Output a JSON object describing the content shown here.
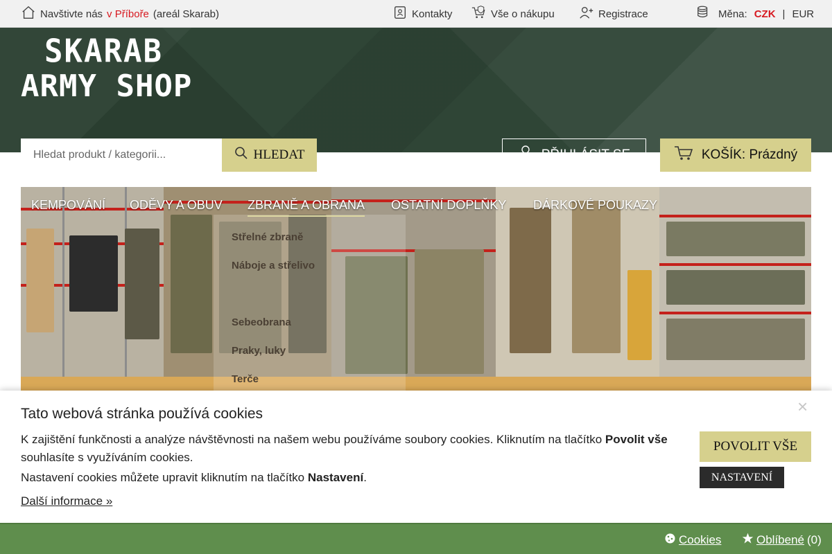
{
  "topbar": {
    "visit_prefix": "Navštivte nás",
    "visit_link": "v Příboře",
    "visit_suffix": "(areál Skarab)",
    "contacts": "Kontakty",
    "shopping_info": "Vše o nákupu",
    "register": "Registrace",
    "currency_label": "Měna:",
    "currency_czk": "CZK",
    "currency_sep": "|",
    "currency_eur": "EUR"
  },
  "logo": {
    "line1": "SKARAB",
    "line2": "ARMY SHOP"
  },
  "search": {
    "placeholder": "Hledat produkt / kategorii...",
    "button": "HLEDAT"
  },
  "login": {
    "label": "PŘIHLÁSIT SE"
  },
  "cart": {
    "label": "KOŠÍK: Prázdný"
  },
  "nav": {
    "items": [
      "KEMPOVÁNÍ",
      "ODĚVY A OBUV",
      "ZBRANĚ A OBRANA",
      "OSTATNÍ DOPLŇKY",
      "DÁRKOVÉ POUKAZY"
    ],
    "active_index": 2,
    "dropdown": [
      "Střelné zbraně",
      "Náboje a střelivo",
      "Sebeobrana",
      "Praky, luky",
      "Terče"
    ]
  },
  "cookie": {
    "title": "Tato webová stránka používá cookies",
    "text_a": "K zajištění funkčnosti a analýze návštěvnosti na našem webu používáme soubory cookies. Kliknutím na tlačítko",
    "text_a_bold": "Povolit vše",
    "text_a_end": "souhlasíte s využíváním cookies.",
    "text_b": "Nastavení cookies můžete upravit kliknutím na tlačítko",
    "text_b_bold": "Nastavení",
    "text_b_end": ".",
    "more": "Další informace »",
    "close": "×",
    "allow_all": "POVOLIT VŠE",
    "settings": "NASTAVENÍ"
  },
  "bottombar": {
    "cookies": "Cookies",
    "favorites": "Oblíbené",
    "favorites_count": "(0)"
  },
  "colors": {
    "header_green": "#2f4536",
    "accent": "#d6d08d",
    "red": "#d71920",
    "bottom_green": "#5f8e4d"
  }
}
